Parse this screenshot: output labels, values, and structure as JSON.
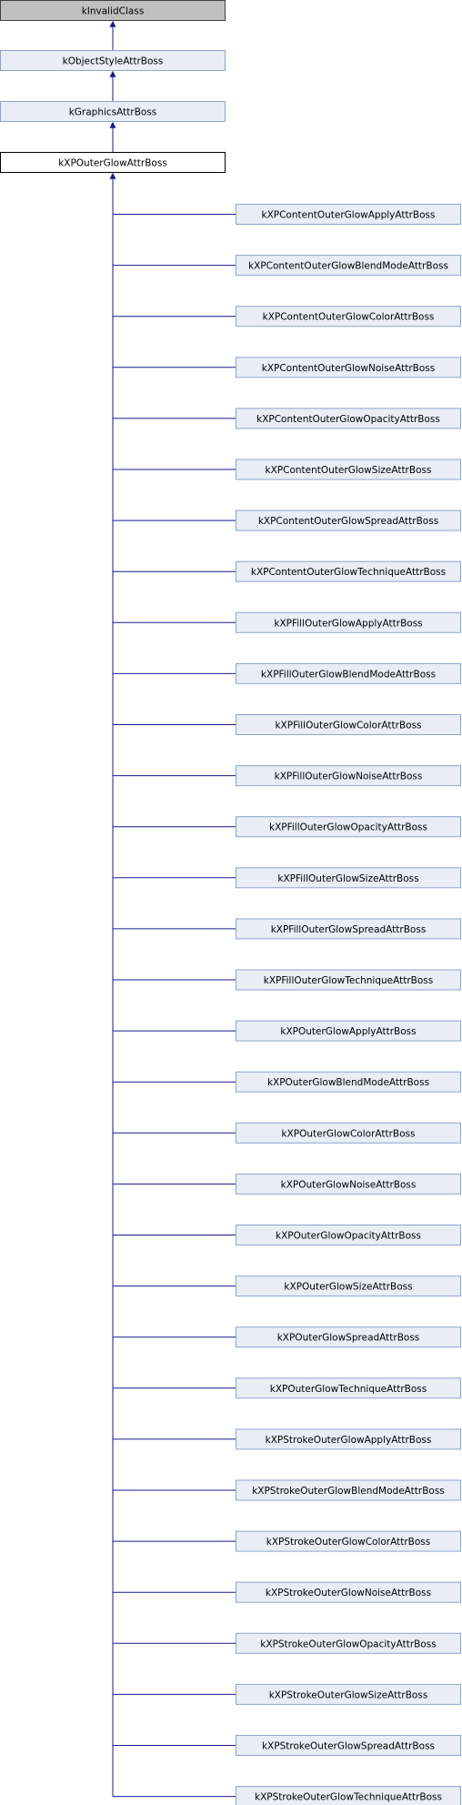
{
  "diagram": {
    "title": "",
    "ancestors": [
      {
        "label": "kInvalidClass",
        "style": "grey"
      },
      {
        "label": "kObjectStyleAttrBoss",
        "style": "blue"
      },
      {
        "label": "kGraphicsAttrBoss",
        "style": "blue"
      },
      {
        "label": "kXPOuterGlowAttrBoss",
        "style": "current"
      }
    ],
    "children": [
      "kXPContentOuterGlowApplyAttrBoss",
      "kXPContentOuterGlowBlendModeAttrBoss",
      "kXPContentOuterGlowColorAttrBoss",
      "kXPContentOuterGlowNoiseAttrBoss",
      "kXPContentOuterGlowOpacityAttrBoss",
      "kXPContentOuterGlowSizeAttrBoss",
      "kXPContentOuterGlowSpreadAttrBoss",
      "kXPContentOuterGlowTechniqueAttrBoss",
      "kXPFillOuterGlowApplyAttrBoss",
      "kXPFillOuterGlowBlendModeAttrBoss",
      "kXPFillOuterGlowColorAttrBoss",
      "kXPFillOuterGlowNoiseAttrBoss",
      "kXPFillOuterGlowOpacityAttrBoss",
      "kXPFillOuterGlowSizeAttrBoss",
      "kXPFillOuterGlowSpreadAttrBoss",
      "kXPFillOuterGlowTechniqueAttrBoss",
      "kXPOuterGlowApplyAttrBoss",
      "kXPOuterGlowBlendModeAttrBoss",
      "kXPOuterGlowColorAttrBoss",
      "kXPOuterGlowNoiseAttrBoss",
      "kXPOuterGlowOpacityAttrBoss",
      "kXPOuterGlowSizeAttrBoss",
      "kXPOuterGlowSpreadAttrBoss",
      "kXPOuterGlowTechniqueAttrBoss",
      "kXPStrokeOuterGlowApplyAttrBoss",
      "kXPStrokeOuterGlowBlendModeAttrBoss",
      "kXPStrokeOuterGlowColorAttrBoss",
      "kXPStrokeOuterGlowNoiseAttrBoss",
      "kXPStrokeOuterGlowOpacityAttrBoss",
      "kXPStrokeOuterGlowSizeAttrBoss",
      "kXPStrokeOuterGlowSpreadAttrBoss",
      "kXPStrokeOuterGlowTechniqueAttrBoss"
    ]
  },
  "colors": {
    "edge": "#1a1a8c",
    "grey_fill": "#c0c0c0",
    "grey_border": "#404040",
    "blue_fill": "#e8edf6",
    "blue_border": "#8ea3cc",
    "current_fill": "#ffffff",
    "current_border": "#000000"
  }
}
